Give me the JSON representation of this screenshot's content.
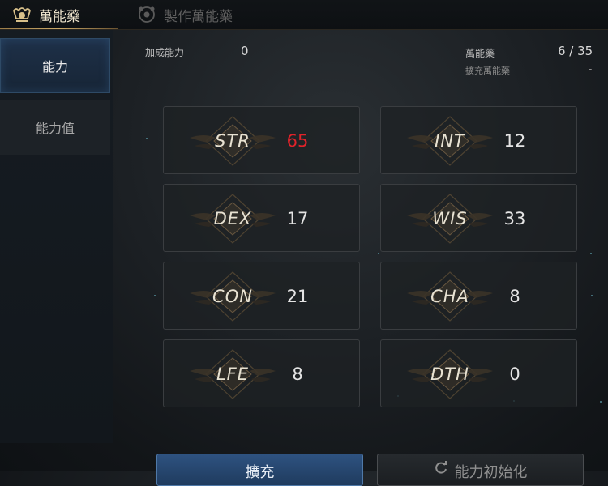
{
  "tabs": [
    {
      "label": "萬能藥",
      "icon": "elixir-icon"
    },
    {
      "label": "製作萬能藥",
      "icon": "craft-elixir-icon"
    }
  ],
  "sidebar": {
    "items": [
      {
        "label": "能力"
      },
      {
        "label": "能力值"
      }
    ]
  },
  "header": {
    "bonus_label": "加成能力",
    "bonus_value": "0",
    "elixir_label": "萬能藥",
    "elixir_value": "6 / 35",
    "expand_label": "擴充萬能藥",
    "expand_value": "-"
  },
  "stats": [
    {
      "name": "STR",
      "value": "65",
      "highlight": "#e0232a"
    },
    {
      "name": "INT",
      "value": "12"
    },
    {
      "name": "DEX",
      "value": "17"
    },
    {
      "name": "WIS",
      "value": "33"
    },
    {
      "name": "CON",
      "value": "21"
    },
    {
      "name": "CHA",
      "value": "8"
    },
    {
      "name": "LFE",
      "value": "8"
    },
    {
      "name": "DTH",
      "value": "0"
    }
  ],
  "buttons": {
    "expand": "擴充",
    "reset": "能力初始化"
  },
  "colors": {
    "accent_gold": "#c9a869",
    "active_blue": "#2e5280",
    "highlight_red": "#e0232a"
  }
}
